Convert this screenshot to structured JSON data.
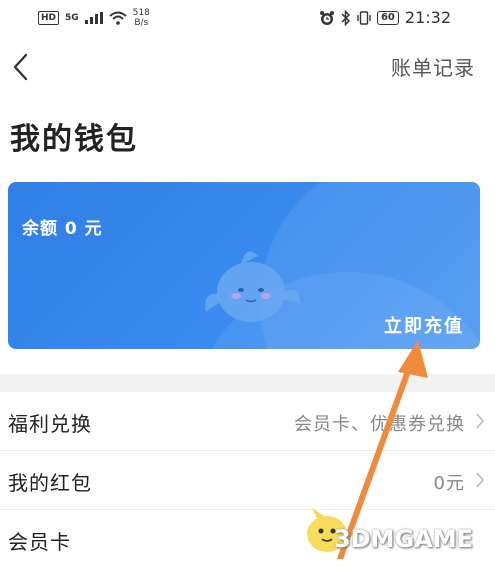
{
  "status_bar": {
    "network": "HD",
    "signal": "5G",
    "speed_top": "518",
    "speed_bottom": "B/s",
    "battery": "60",
    "time": "21:32"
  },
  "nav": {
    "back_icon": "chevron-left-icon",
    "bill_records": "账单记录"
  },
  "page_title": "我的钱包",
  "wallet_card": {
    "balance_text": "余额 0 元",
    "recharge_label": "立即充值",
    "background_color": "#3585ec"
  },
  "list": [
    {
      "label": "福利兑换",
      "value": "会员卡、优惠券兑换",
      "has_chevron": true
    },
    {
      "label": "我的红包",
      "value": "0元",
      "has_chevron": true
    },
    {
      "label": "会员卡",
      "value": "",
      "has_chevron": false
    }
  ],
  "annotation": {
    "arrow_color": "#f08a3c"
  },
  "watermark": {
    "text": "3DMGAME"
  }
}
